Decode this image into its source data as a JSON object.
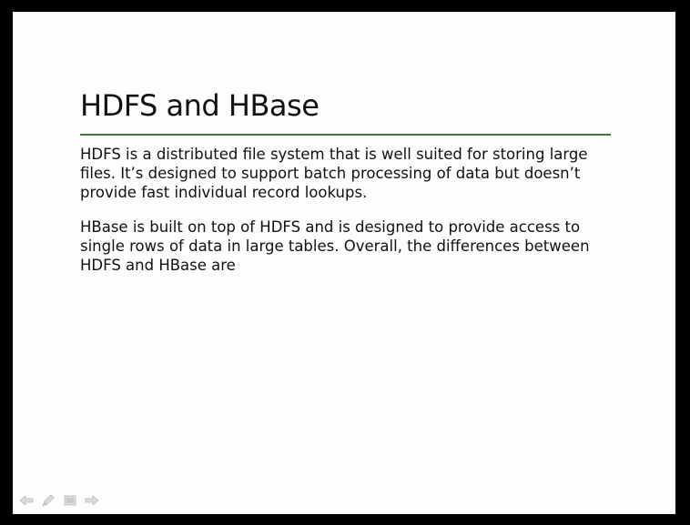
{
  "slide": {
    "title": "HDFS and HBase",
    "paragraphs": [
      "HDFS is a distributed file system that is well suited for storing large files. It’s designed to support batch processing of data but doesn’t provide fast individual record lookups.",
      "HBase is built on top of HDFS and is designed to provide access to single rows of data in large tables. Overall, the differences between HDFS and HBase are"
    ]
  },
  "colors": {
    "background_frame": "#000000",
    "slide_background": "#fdfdfb",
    "title_rule": "#3a7a3f",
    "text": "#111111",
    "nav_icons": "#c8c8c8"
  },
  "navigation": {
    "icons": [
      "previous-arrow-icon",
      "pen-icon",
      "menu-icon",
      "next-arrow-icon"
    ]
  }
}
